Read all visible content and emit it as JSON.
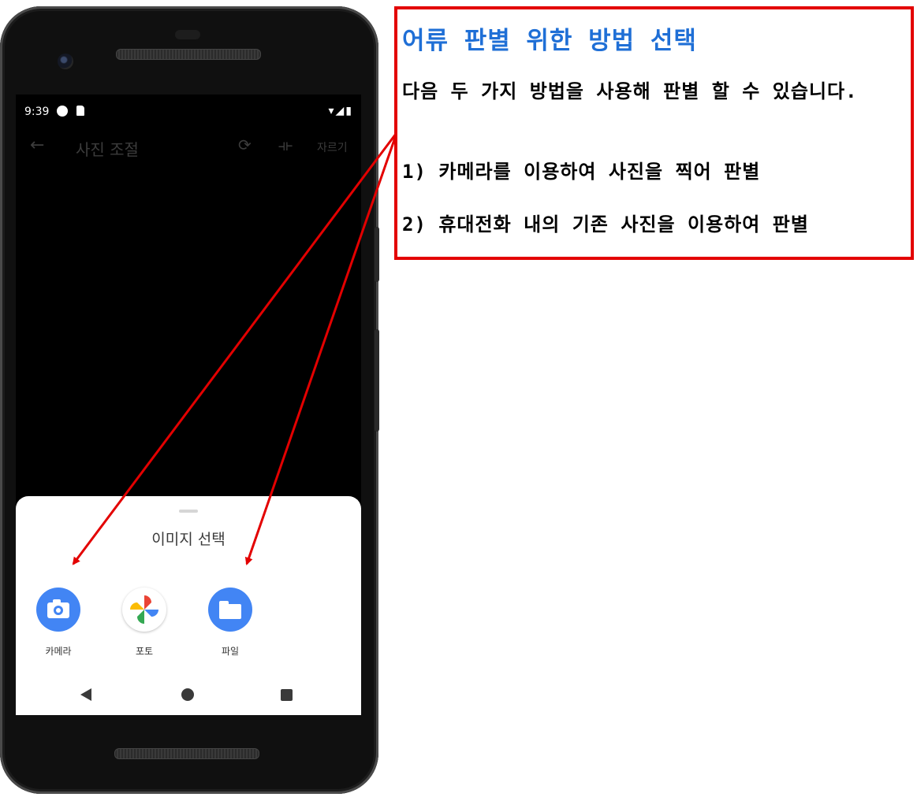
{
  "status_bar": {
    "time": "9:39"
  },
  "app_bar": {
    "back_icon": "←",
    "title": "사진 조절",
    "rotate_icon": "⟳",
    "flip_icon": "⟛",
    "crop_label": "자르기"
  },
  "sheet": {
    "title": "이미지 선택",
    "apps": [
      {
        "label": "카메라",
        "icon": "camera-icon",
        "color": "#4285f4"
      },
      {
        "label": "포토",
        "icon": "photos-pinwheel-icon",
        "color": "#ffffff"
      },
      {
        "label": "파일",
        "icon": "folder-icon",
        "color": "#4285f4"
      }
    ]
  },
  "note": {
    "title": "어류 판별 위한 방법 선택",
    "line1": "다음 두 가지 방법을 사용해 판별 할 수 있습니다.",
    "line2": "1) 카메라를 이용하여 사진을 찍어 판별",
    "line3": "2) 휴대전화 내의 기존 사진을 이용하여 판별"
  },
  "colors": {
    "annotation_red": "#e30000",
    "title_blue": "#1f6fd6"
  }
}
